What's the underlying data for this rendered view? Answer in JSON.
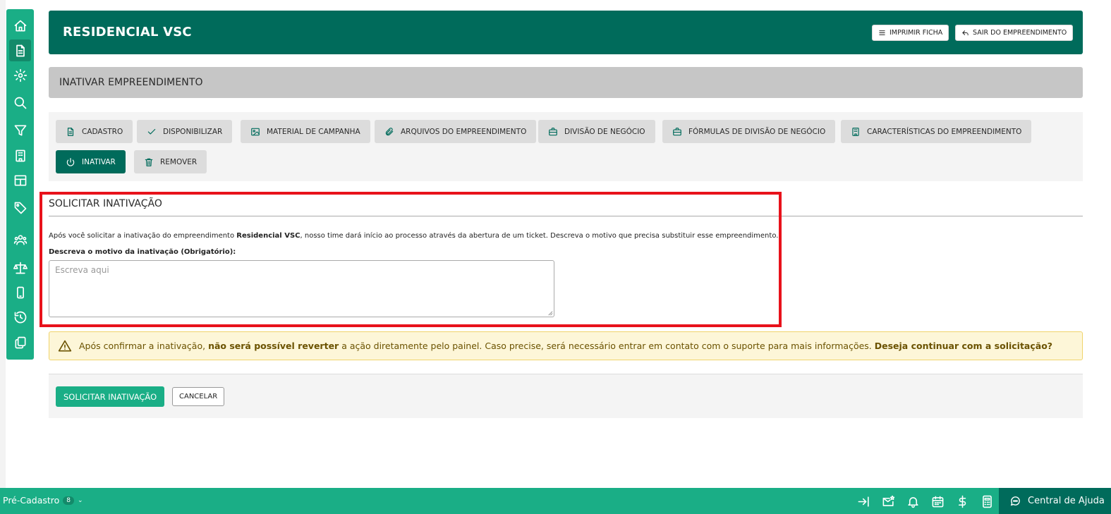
{
  "header": {
    "title": "RESIDENCIAL VSC",
    "print_label": "IMPRIMIR FICHA",
    "exit_label": "SAIR DO EMPREENDIMENTO"
  },
  "section": {
    "title": "INATIVAR EMPREENDIMENTO"
  },
  "sidebar": {
    "items": [
      {
        "name": "home-icon",
        "active": false
      },
      {
        "name": "document-icon",
        "active": true
      },
      {
        "name": "gear-icon",
        "active": false
      },
      {
        "name": "search-icon",
        "active": false
      },
      {
        "name": "filter-icon",
        "active": false
      },
      {
        "name": "building-icon",
        "active": false
      },
      {
        "name": "table-icon",
        "active": false
      },
      {
        "name": "tag-icon",
        "active": false
      },
      {
        "name": "users-icon",
        "active": false
      },
      {
        "name": "scale-icon",
        "active": false
      },
      {
        "name": "phone-icon",
        "active": false
      },
      {
        "name": "history-icon",
        "active": false
      },
      {
        "name": "copy-icon",
        "active": false
      }
    ]
  },
  "tabs": [
    {
      "label": "CADASTRO",
      "icon": "document-icon"
    },
    {
      "label": "DISPONIBILIZAR",
      "icon": "check-icon"
    },
    {
      "label": "MATERIAL DE CAMPANHA",
      "icon": "image-icon"
    },
    {
      "label": "ARQUIVOS DO EMPREENDIMENTO",
      "icon": "paperclip-icon"
    },
    {
      "label": "DIVISÃO DE NEGÓCIO",
      "icon": "briefcase-icon"
    },
    {
      "label": "FÓRMULAS DE DIVISÃO DE NEGÓCIO",
      "icon": "briefcase-icon"
    },
    {
      "label": "CARACTERÍSTICAS DO EMPREENDIMENTO",
      "icon": "building-icon"
    },
    {
      "label": "INATIVAR",
      "icon": "power-icon",
      "active": true
    },
    {
      "label": "REMOVER",
      "icon": "trash-icon"
    }
  ],
  "form": {
    "title": "SOLICITAR INATIVAÇÃO",
    "desc_pre": "Após você solicitar a inativação do empreendimento ",
    "desc_name": "Residencial VSC",
    "desc_post": ", nosso time dará início ao processo através da abertura de um ticket. Descreva o motivo que precisa substituir esse empreendimento.",
    "label": "Descreva o motivo da inativação (Obrigatório):",
    "placeholder": "Escreva aqui",
    "value": ""
  },
  "warning": {
    "pre": "Após confirmar a inativação, ",
    "strong1": "não será possível reverter",
    "mid": " a ação diretamente pelo painel. Caso precise, será necessário entrar em contato com o suporte para mais informações. ",
    "strong2": "Deseja continuar com a solicitação?"
  },
  "actions": {
    "submit_label": "SOLICITAR INATIVAÇÃO",
    "cancel_label": "CANCELAR"
  },
  "bottombar": {
    "precadastro_label": "Pré-Cadastro",
    "precadastro_count": "8",
    "help_label": "Central de Ajuda",
    "icons": [
      "login-arrow-icon",
      "mail-star-icon",
      "bell-icon",
      "calendar-icon",
      "dollar-icon",
      "calculator-icon"
    ]
  },
  "colors": {
    "primary_dark": "#006b5b",
    "primary": "#1aae86",
    "highlight_frame": "#e8121b",
    "warning_bg": "#fdf6d8"
  }
}
